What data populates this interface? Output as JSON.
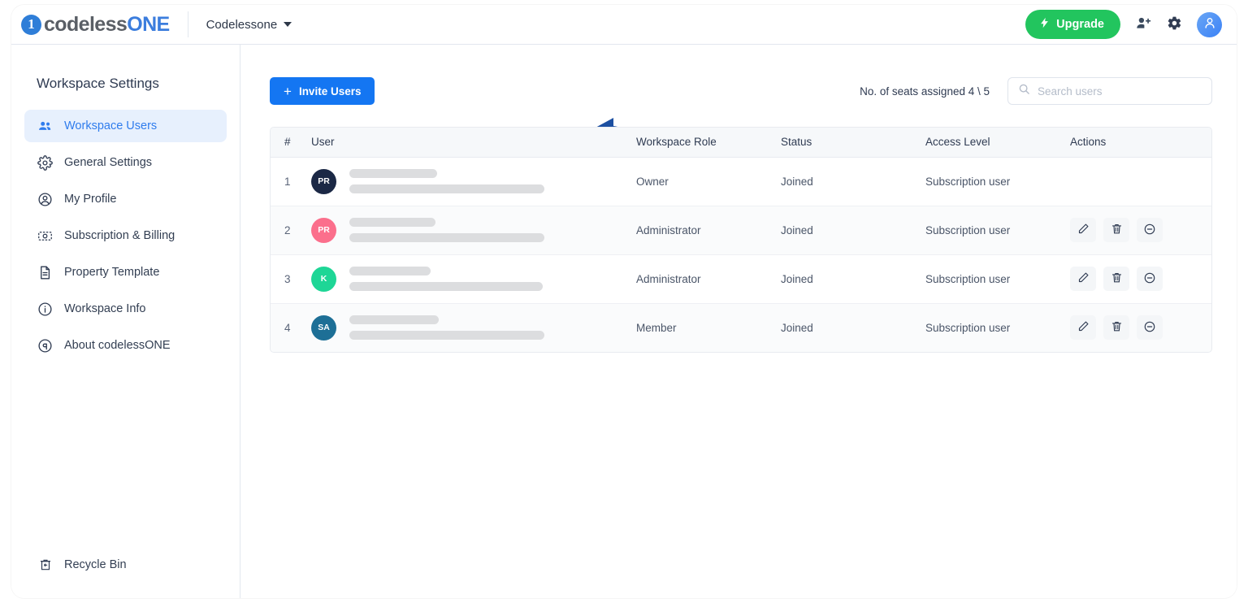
{
  "topbar": {
    "logo_light": "codeless",
    "logo_accent": "ONE",
    "logo_mark": "circle-one-logo",
    "workspace_name": "Codelessone",
    "upgrade_label": "Upgrade",
    "upgrade_icon": "lightning-bolt-icon",
    "color_upgrade": "#22c55e",
    "add_user_icon": "user-plus-icon",
    "settings_icon": "gear-icon",
    "profile_icon": "user-avatar-icon"
  },
  "sidebar": {
    "title": "Workspace Settings",
    "items": [
      {
        "label": "Workspace Users",
        "icon": "users-group-icon",
        "active": true
      },
      {
        "label": "General Settings",
        "icon": "gear-icon",
        "active": false
      },
      {
        "label": "My Profile",
        "icon": "user-circle-icon",
        "active": false
      },
      {
        "label": "Subscription & Billing",
        "icon": "banknote-icon",
        "active": false
      },
      {
        "label": "Property Template",
        "icon": "document-icon",
        "active": false
      },
      {
        "label": "Workspace Info",
        "icon": "info-circle-icon",
        "active": false
      },
      {
        "label": "About codelessONE",
        "icon": "copyright-icon",
        "active": false
      }
    ],
    "footer": {
      "label": "Recycle Bin",
      "icon": "recycle-bin-icon"
    },
    "color_active_bg": "#e7f0fd",
    "color_active_text": "#2f7ced"
  },
  "toolbar": {
    "invite_label": "Invite Users",
    "invite_plus": "+",
    "invite_color": "#1476f2",
    "seats_text": "No. of seats assigned 4 \\ 5",
    "search_placeholder": "Search users",
    "search_value": "",
    "search_icon": "search-icon",
    "annotation_arrow": "curved-arrow-pointing-left"
  },
  "table": {
    "columns": [
      "#",
      "User",
      "Workspace Role",
      "Status",
      "Access Level",
      "Actions"
    ],
    "rows": [
      {
        "num": "1",
        "initials": "PR",
        "avatar_color": "#1b2845",
        "role": "Owner",
        "status": "Joined",
        "access": "Subscription user",
        "name_redacted": true,
        "email_redacted": true,
        "has_actions": false
      },
      {
        "num": "2",
        "initials": "PR",
        "avatar_color": "#fb6f8c",
        "role": "Administrator",
        "status": "Joined",
        "access": "Subscription user",
        "name_redacted": true,
        "email_redacted": true,
        "has_actions": true
      },
      {
        "num": "3",
        "initials": "K",
        "avatar_color": "#1ed696",
        "role": "Administrator",
        "status": "Joined",
        "access": "Subscription user",
        "name_redacted": true,
        "email_redacted": true,
        "has_actions": true
      },
      {
        "num": "4",
        "initials": "SA",
        "avatar_color": "#1d6f96",
        "role": "Member",
        "status": "Joined",
        "access": "Subscription user",
        "name_redacted": true,
        "email_redacted": true,
        "has_actions": true
      }
    ],
    "action_icons": [
      "pencil-edit-icon",
      "trash-delete-icon",
      "circle-minus-remove-icon"
    ]
  }
}
